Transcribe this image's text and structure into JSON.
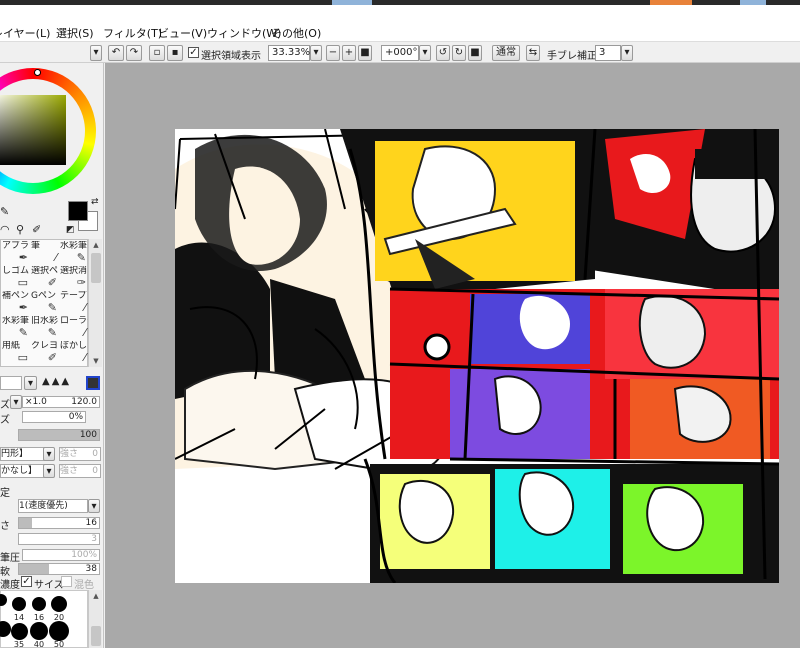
{
  "menu": {
    "layer": "レイヤー(L)",
    "select": "選択(S)",
    "filter": "フィルタ(T)",
    "view": "ビュー(V)",
    "window": "ウィンドウ(W)",
    "other": "その他(O)"
  },
  "toolbar": {
    "select_region_label": "選択領域表示",
    "zoom": "33.33%",
    "rotation": "+000°",
    "blend_mode": "通常",
    "stabilizer_label": "手ブレ補正",
    "stabilizer_value": "3"
  },
  "tools": [
    {
      "label": "アブラシ",
      "icon": "airbrush-icon"
    },
    {
      "label": "筆",
      "icon": "brush-icon"
    },
    {
      "label": "水彩筆",
      "icon": "watercolor-icon"
    },
    {
      "label": "しゴム",
      "icon": "eraser-icon"
    },
    {
      "label": "選択ペン",
      "icon": "select-pen-icon"
    },
    {
      "label": "選択消し",
      "icon": "select-erase-icon"
    },
    {
      "label": "補ペン",
      "icon": "pen-icon"
    },
    {
      "label": "Gペン",
      "icon": "gpen-icon"
    },
    {
      "label": "テープ",
      "icon": "tape-icon"
    },
    {
      "label": "水彩筆",
      "icon": "watercolor-icon"
    },
    {
      "label": "旧水彩",
      "icon": "old-watercolor-icon"
    },
    {
      "label": "ローラー",
      "icon": "roller-icon"
    },
    {
      "label": "用紙",
      "icon": "paper-icon"
    },
    {
      "label": "クレヨン",
      "icon": "crayon-icon"
    },
    {
      "label": "ぼかし",
      "icon": "blur-icon"
    }
  ],
  "brush": {
    "size_multiplier": "×1.0",
    "size_value": "120.0",
    "min_size": "0%",
    "density": "100",
    "shape": "円形】",
    "texture": "かなし】",
    "strength1": "強さ",
    "strength1_value": "0",
    "strength2": "強さ",
    "strength2_value": "0",
    "advanced_label": "定",
    "quality": "1(速度優先)",
    "edge_hardness": "16",
    "min_density": "3",
    "max_pressure_label": "筆圧",
    "max_pressure": "100%",
    "pressure_hard_label": "軟",
    "pressure_hard": "38",
    "density_label": "濃度",
    "size_check_label": "サイズ",
    "blend_check_label": "混色"
  },
  "brush_sizes": [
    {
      "label": "14",
      "size": 14
    },
    {
      "label": "16",
      "size": 14
    },
    {
      "label": "20",
      "size": 16
    },
    {
      "label": "35",
      "size": 17
    },
    {
      "label": "40",
      "size": 18
    },
    {
      "label": "50",
      "size": 20
    }
  ],
  "colors": {
    "foreground": "#000000",
    "background": "#ffffff",
    "workspace": "#a9a9a9"
  }
}
